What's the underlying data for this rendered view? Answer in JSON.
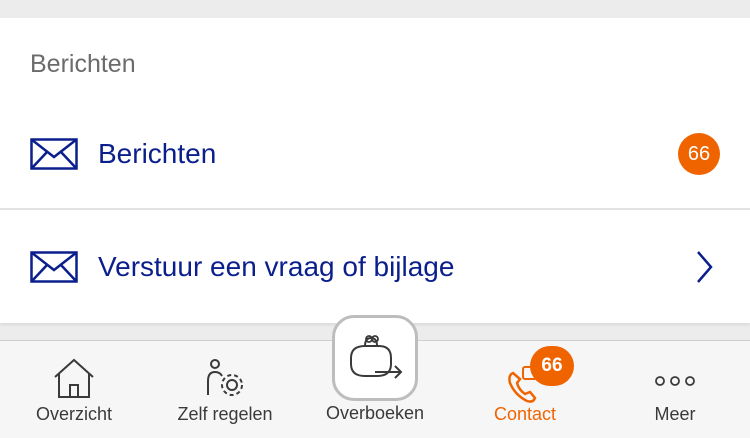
{
  "section": {
    "title": "Berichten"
  },
  "rows": [
    {
      "label": "Berichten",
      "badge": "66",
      "icon": "envelope-icon"
    },
    {
      "label": "Verstuur een vraag of bijlage",
      "icon": "envelope-icon",
      "trailing_icon": "chevron-right-icon"
    }
  ],
  "bottom_nav": {
    "tabs": [
      {
        "label": "Overzicht",
        "icon": "home-icon"
      },
      {
        "label": "Zelf regelen",
        "icon": "person-gear-icon"
      },
      {
        "label": "Overboeken",
        "icon": "wallet-transfer-icon"
      },
      {
        "label": "Contact",
        "icon": "phone-message-icon",
        "badge": "66",
        "active": true
      },
      {
        "label": "Meer",
        "icon": "more-dots-icon"
      }
    ]
  },
  "colors": {
    "accent": "#f06400",
    "link": "#0b1f8c",
    "background": "#ececec"
  }
}
